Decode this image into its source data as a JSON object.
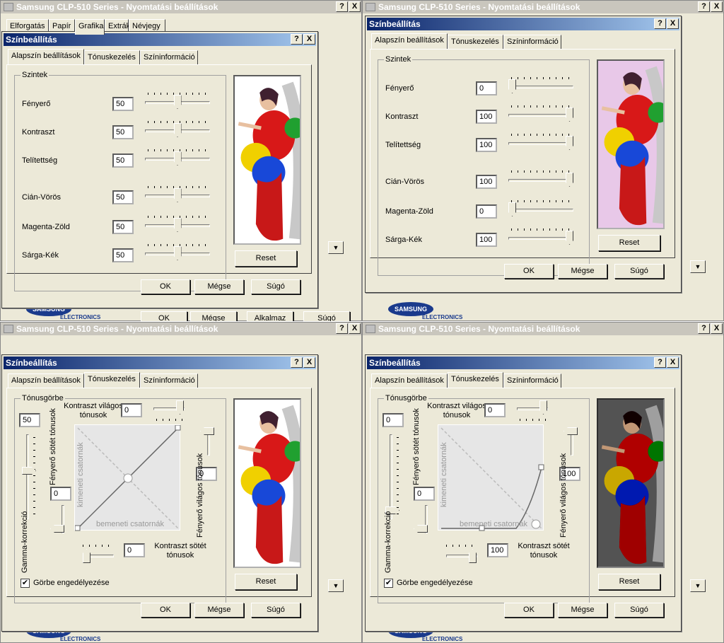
{
  "printer_window": {
    "title": "Samsung CLP-510 Series - Nyomtatási beállítások",
    "tabs": [
      "Elforgatás",
      "Papír",
      "Grafika",
      "Extrák",
      "Névjegy"
    ],
    "buttons": {
      "ok": "OK",
      "cancel": "Mégse",
      "apply": "Alkalmaz",
      "help": "Súgó"
    },
    "logo_main": "SAMSUNG",
    "logo_sub": "ELECTRONICS",
    "title_help": "?",
    "title_close": "X"
  },
  "dialog": {
    "title": "Színbeállítás",
    "tabs": [
      "Alapszín beállítások",
      "Tónuskezelés",
      "Színinformáció"
    ],
    "levels_group": "Szintek",
    "tone_group": "Tónusgörbe",
    "buttons": {
      "reset": "Reset",
      "ok": "OK",
      "cancel": "Mégse",
      "help": "Súgó"
    },
    "checkbox_label": "Görbe engedélyezése",
    "checkbox_mark": "✔"
  },
  "levels": {
    "labels": [
      "Fényerő",
      "Kontraszt",
      "Telítettség",
      "Cián-Vörös",
      "Magenta-Zöld",
      "Sárga-Kék"
    ],
    "default_values": [
      "50",
      "50",
      "50",
      "50",
      "50",
      "50"
    ],
    "adjusted_values": [
      "0",
      "100",
      "100",
      "100",
      "0",
      "100"
    ],
    "default_levels": [
      50,
      50,
      50,
      50,
      50,
      50
    ],
    "adjusted_levels": [
      0,
      100,
      100,
      100,
      0,
      100
    ]
  },
  "tone": {
    "contrast_light_label": "Kontraszt világos tónusok",
    "contrast_dark_label": "Kontraszt sötét tónusok",
    "bright_dark_label": "Fényerő sötét tónusok",
    "bright_light_label": "Fényerő világos tónusok",
    "gamma_label": "Gamma-korrekció",
    "input_axis": "bemeneti csatornák",
    "output_axis": "kimeneti csatornák",
    "default": {
      "gamma": "50",
      "contrast_light": "0",
      "bright_dark": "0",
      "bright_light": "0",
      "contrast_dark": "0"
    },
    "adjusted": {
      "gamma": "0",
      "contrast_light": "0",
      "bright_dark": "0",
      "bright_light": "100",
      "contrast_dark": "100"
    }
  },
  "colors": {
    "title_start": "#0a246a",
    "title_end": "#a6caf0",
    "face": "#ece9d8",
    "preview_tint": "#e8c8e8"
  }
}
